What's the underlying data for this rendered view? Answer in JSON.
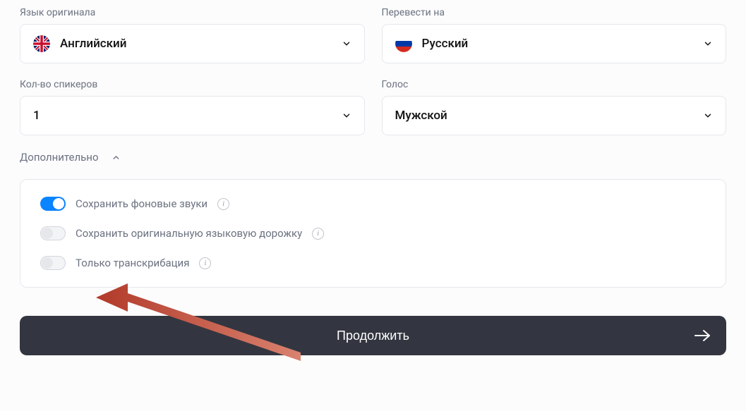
{
  "sourceLang": {
    "label": "Язык оригинала",
    "value": "Английский"
  },
  "targetLang": {
    "label": "Перевести на",
    "value": "Русский"
  },
  "speakers": {
    "label": "Кол-во спикеров",
    "value": "1"
  },
  "voice": {
    "label": "Голос",
    "value": "Мужской"
  },
  "advanced": {
    "label": "Дополнительно",
    "options": {
      "keepBackground": {
        "label": "Сохранить фоновые звуки",
        "on": true
      },
      "keepOriginalTrack": {
        "label": "Сохранить оригинальную языковую дорожку",
        "on": false
      },
      "transcriptionOnly": {
        "label": "Только транскрибация",
        "on": false
      }
    }
  },
  "continueLabel": "Продолжить"
}
